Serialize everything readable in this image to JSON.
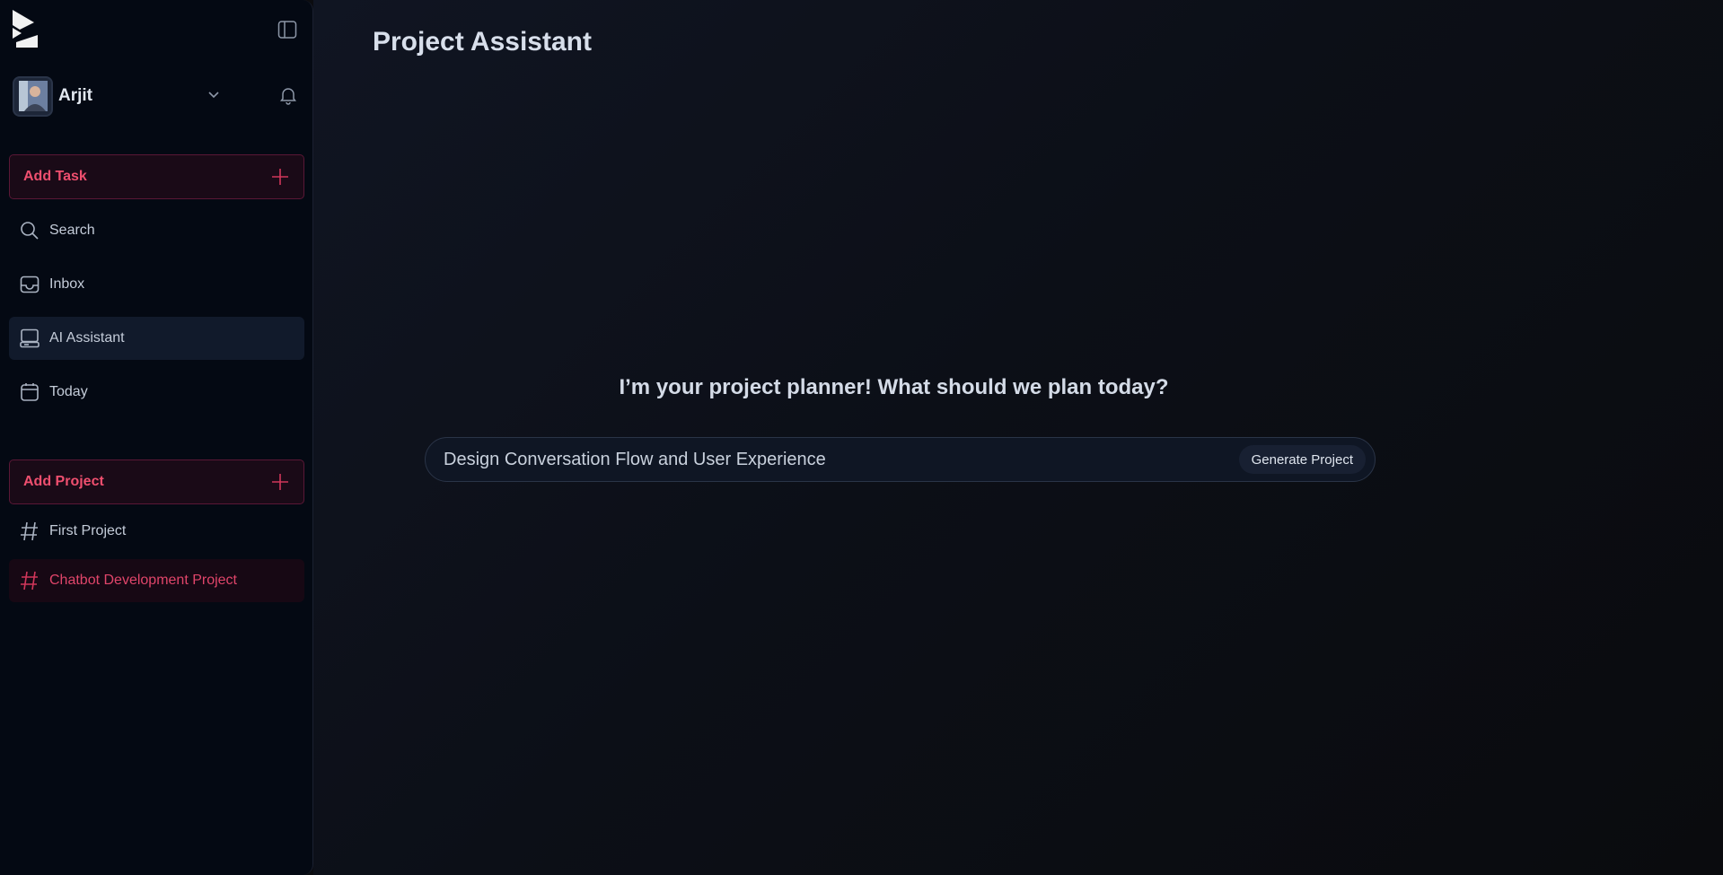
{
  "sidebar": {
    "user": {
      "name": "Arjit"
    },
    "add_task_label": "Add Task",
    "nav": [
      {
        "label": "Search",
        "icon": "search-icon"
      },
      {
        "label": "Inbox",
        "icon": "inbox-icon"
      },
      {
        "label": "AI Assistant",
        "icon": "ai-assistant-icon",
        "active": true
      },
      {
        "label": "Today",
        "icon": "calendar-icon"
      }
    ],
    "add_project_label": "Add Project",
    "projects": [
      {
        "label": "First Project",
        "icon": "hash-icon"
      },
      {
        "label": "Chatbot Development Project",
        "icon": "hash-icon",
        "active": true
      }
    ]
  },
  "main": {
    "title": "Project Assistant",
    "prompt_heading": "I’m your project planner! What should we plan today?",
    "input_value": "Design Conversation Flow and User Experience",
    "generate_label": "Generate Project"
  },
  "colors": {
    "accent": "#ef4f6f",
    "sidebar_bg": "#040913",
    "main_bg": "#0c0f17"
  }
}
